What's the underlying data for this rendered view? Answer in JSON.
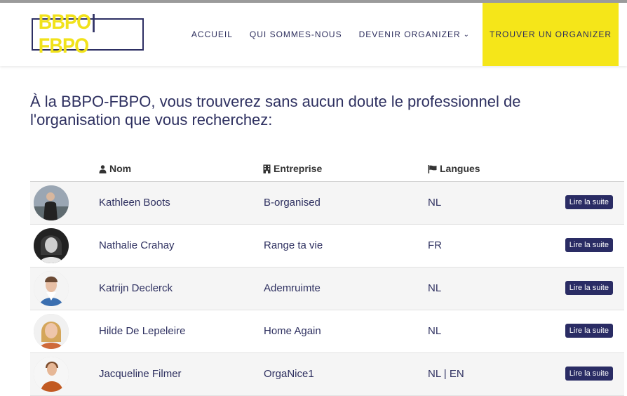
{
  "brand": {
    "logo_left": "BBPO",
    "logo_right": "FBPO"
  },
  "nav": {
    "items": [
      {
        "label": "ACCUEIL"
      },
      {
        "label": "QUI SOMMES-NOUS"
      },
      {
        "label": "DEVENIR ORGANIZER"
      },
      {
        "label": "TROUVER UN ORGANIZER"
      }
    ]
  },
  "intro": "À la BBPO-FBPO, vous trouverez sans aucun doute le professionnel de l'organisation que vous recherchez:",
  "table": {
    "headers": {
      "name": "Nom",
      "company": "Entreprise",
      "languages": "Langues"
    },
    "rows": [
      {
        "name": "Kathleen Boots",
        "company": "B-organised",
        "languages": "NL",
        "button": "Lire la suite"
      },
      {
        "name": "Nathalie Crahay",
        "company": "Range ta vie",
        "languages": "FR",
        "button": "Lire la suite"
      },
      {
        "name": "Katrijn Declerck",
        "company": "Ademruimte",
        "languages": "NL",
        "button": "Lire la suite"
      },
      {
        "name": "Hilde De Lepeleire",
        "company": "Home Again",
        "languages": "NL",
        "button": "Lire la suite"
      },
      {
        "name": "Jacqueline Filmer",
        "company": "OrgaNice1",
        "languages": "NL | EN",
        "button": "Lire la suite"
      }
    ]
  },
  "colors": {
    "accent": "#f5e619",
    "navy": "#2a2c64"
  },
  "icons": [
    "chevron-down-icon",
    "user-icon",
    "building-icon",
    "flag-icon"
  ]
}
